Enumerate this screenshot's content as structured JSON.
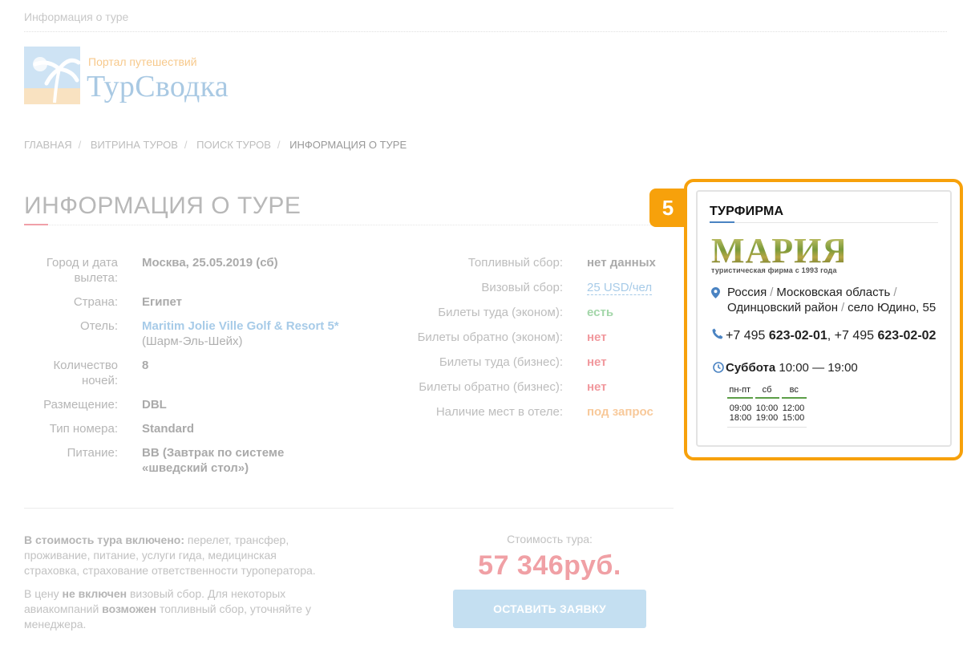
{
  "top_title": "Информация о туре",
  "logo": {
    "tagline": "Портал путешествий",
    "name": "ТурСводка"
  },
  "breadcrumb": [
    {
      "label": "Главная"
    },
    {
      "label": "Витрина туров"
    },
    {
      "label": "Поиск туров"
    },
    {
      "label": "Информация о туре"
    }
  ],
  "page_title": "ИНФОРМАЦИЯ О ТУРЕ",
  "tour_details": {
    "departure_label": "Город и дата вылета:",
    "departure_value": "Москва, 25.05.2019 (сб)",
    "country_label": "Страна:",
    "country_value": "Египет",
    "hotel_label": "Отель:",
    "hotel_name": "Maritim Jolie Ville Golf & Resort 5*",
    "hotel_location": "(Шарм-Эль-Шейх)",
    "nights_label": "Количество ночей:",
    "nights_value": "8",
    "placement_label": "Размещение:",
    "placement_value": "DBL",
    "room_label": "Тип номера:",
    "room_value": "Standard",
    "meal_label": "Питание:",
    "meal_value": "BB (Завтрак по системе «шведский стол»)"
  },
  "extra_info": {
    "fuel_label": "Топливный сбор:",
    "fuel_value": "нет данных",
    "visa_label": "Визовый сбор:",
    "visa_value": "25 USD/чел",
    "econ_out_label": "Билеты туда (эконом):",
    "econ_out_value": "есть",
    "econ_back_label": "Билеты обратно (эконом):",
    "econ_back_value": "нет",
    "biz_out_label": "Билеты туда (бизнес):",
    "biz_out_value": "нет",
    "biz_back_label": "Билеты обратно (бизнес):",
    "biz_back_value": "нет",
    "hotel_avail_label": "Наличие мест в отеле:",
    "hotel_avail_value": "под запрос"
  },
  "included": {
    "included_label": "В стоимость тура включено:",
    "included_text": " перелет, трансфер, проживание, питание, услуги гида, медицинская страховка, страхование ответственности туроператора.",
    "excl_prefix": "В цену ",
    "excl_bold": "не включен",
    "excl_mid": " визовый сбор. Для некоторых авиакомпаний ",
    "excl_bold2": "возможен",
    "excl_suffix": " топливный сбор, уточняйте у менеджера."
  },
  "price": {
    "label": "Стоимость тура:",
    "value": "57 346руб.",
    "button": "Оставить заявку"
  },
  "badge": "5",
  "agency": {
    "title": "Турфирма",
    "logo_word": "МАРИЯ",
    "logo_sub": "туристическая фирма   с 1993 года",
    "address_parts": [
      "Россия",
      "Московская область",
      "Одинцовский район",
      "село Юдино, 55"
    ],
    "phone1_prefix": "+7 495 ",
    "phone1_main": "623-02-01",
    "phone2_prefix": "+7 495 ",
    "phone2_main": "623-02-02",
    "today_day": "Суббота",
    "today_hours": "10:00 — 19:00",
    "schedule": {
      "days": [
        "пн-пт",
        "сб",
        "вс"
      ],
      "open": [
        "09:00",
        "10:00",
        "12:00"
      ],
      "close": [
        "18:00",
        "19:00",
        "15:00"
      ]
    }
  },
  "colors": {
    "highlight": "#f7a10b",
    "accent_blue": "#4a83c2",
    "price": "#f0a0a5",
    "schedule_green": "#5c9e47"
  }
}
